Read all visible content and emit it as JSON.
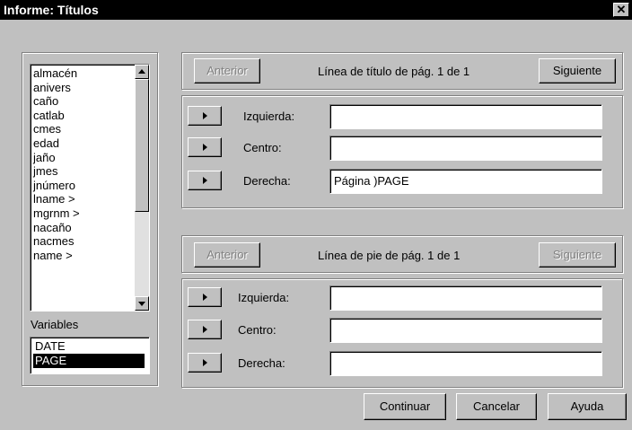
{
  "window": {
    "title": "Informe: Títulos"
  },
  "variables_list": {
    "items": [
      "almacén",
      "anivers",
      "caño",
      "catlab",
      "cmes",
      "edad",
      "jaño",
      "jmes",
      "jnúmero",
      "lname  >",
      "mgrnm  >",
      "nacaño",
      "nacmes",
      "name  >"
    ]
  },
  "special_vars": {
    "label": "Variables",
    "items": [
      "DATE",
      "PAGE"
    ],
    "selected": "PAGE"
  },
  "title_section": {
    "prev_label": "Anterior",
    "heading": "Línea de título de pág. 1 de 1",
    "next_label": "Siguiente",
    "rows": [
      {
        "label": "Izquierda:",
        "value": ""
      },
      {
        "label": "Centro:",
        "value": ""
      },
      {
        "label": "Derecha:",
        "value": "Página )PAGE"
      }
    ]
  },
  "footer_section": {
    "prev_label": "Anterior",
    "heading": "Línea de pie de pág. 1 de 1",
    "next_label": "Siguiente",
    "rows": [
      {
        "label": "Izquierda:",
        "value": ""
      },
      {
        "label": "Centro:",
        "value": ""
      },
      {
        "label": "Derecha:",
        "value": ""
      }
    ]
  },
  "buttons": {
    "continue": "Continuar",
    "cancel": "Cancelar",
    "help": "Ayuda"
  },
  "colors": {
    "titlebar": "#000000",
    "face": "#c0c0c0",
    "selection": "#000000"
  }
}
